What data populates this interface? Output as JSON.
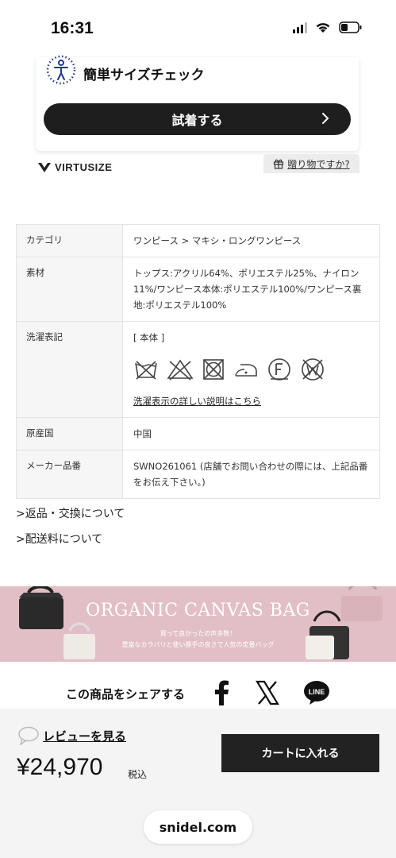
{
  "status_bar": {
    "time": "16:31"
  },
  "size_check": {
    "label": "簡単サイズチェック",
    "try_button": "試着する"
  },
  "virtusize": {
    "brand": "VIRTUSIZE"
  },
  "gift": {
    "label": "贈り物ですか?"
  },
  "spec_table": {
    "rows": [
      {
        "key": "カテゴリ",
        "value": "ワンピース > マキシ・ロングワンピース"
      },
      {
        "key": "素材",
        "value": "トップス:アクリル64%、ポリエステル25%、ナイロン11%/ワンピース本体:ポリエステル100%/ワンピース裏地:ポリエステル100%"
      },
      {
        "key": "洗濯表記",
        "value": "[ 本体 ]",
        "link": "洗濯表示の詳しい説明はこちら"
      },
      {
        "key": "原産国",
        "value": "中国"
      },
      {
        "key": "メーカー品番",
        "value": "SWNO261061 (店舗でお問い合わせの際には、上記品番をお伝え下さい。)"
      }
    ],
    "care_icons": [
      "no-wash-icon",
      "no-bleach-icon",
      "no-tumble-dry-icon",
      "iron-low-icon",
      "dry-clean-f-icon",
      "no-wet-clean-icon"
    ]
  },
  "links": {
    "returns": ">返品・交換について",
    "shipping": ">配送料について"
  },
  "banner": {
    "title": "ORGANIC CANVAS BAG",
    "subtitle1": "買って良かったの声多数！",
    "subtitle2": "豊富なカラバリと使い勝手の良さで人気の定番バッグ",
    "color": "#e2bfc6"
  },
  "share": {
    "label": "この商品をシェアする",
    "icons": [
      "facebook-icon",
      "x-icon",
      "line-icon"
    ],
    "line_text": "LINE"
  },
  "purchase": {
    "review_link": "レビューを見る",
    "price": "¥24,970",
    "tax_label": "税込",
    "cart_button": "カートに入れる"
  },
  "browser": {
    "url": "snidel.com"
  }
}
